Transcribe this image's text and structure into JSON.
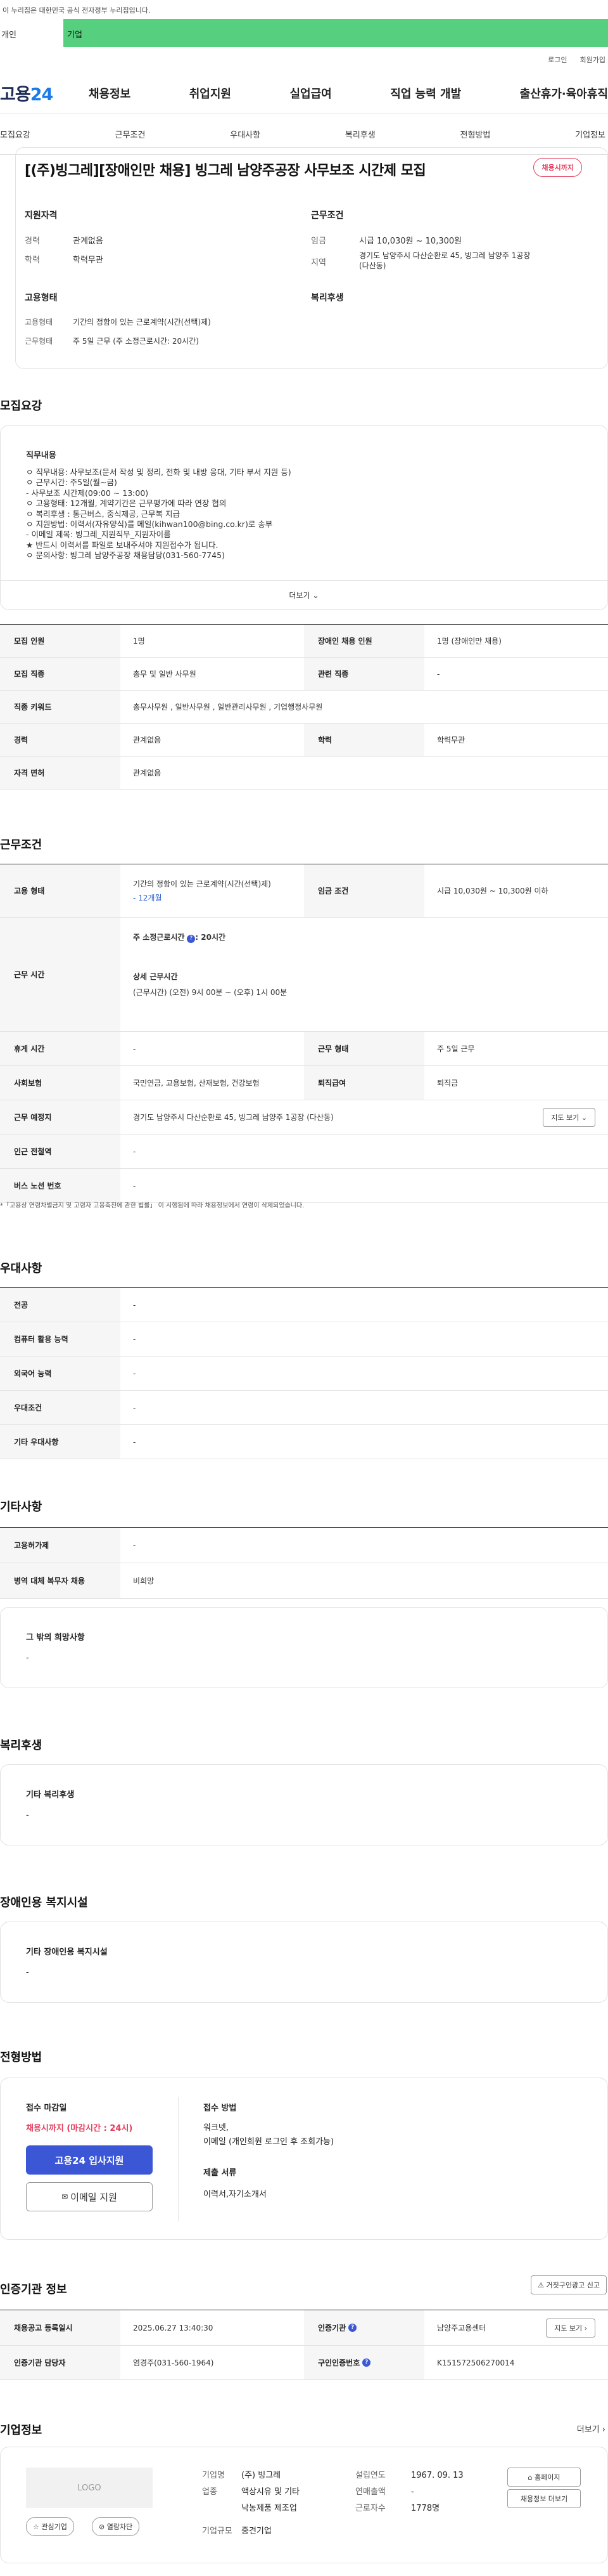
{
  "gov_banner": "이 누리집은 대한민국 공식 전자정부 누리집입니다.",
  "topbar": {
    "left": "개인",
    "right": "기업"
  },
  "util": {
    "login": "로그인",
    "join": "회원가입"
  },
  "logo": {
    "a": "고용",
    "b": "24"
  },
  "gnb": [
    "채용정보",
    "취업지원",
    "실업급여",
    "직업 능력 개발",
    "출산휴가·육아휴직"
  ],
  "tabs": [
    "모집요강",
    "근무조건",
    "우대사항",
    "복리후생",
    "전형방법",
    "기업정보"
  ],
  "job": {
    "title": "[(주)빙그레][장애인만 채용] 빙그레 남양주공장 사무보조 시간제 모집",
    "badge": "채용시까지",
    "qual_h": "지원자격",
    "cond_h": "근무조건",
    "career_k": "경력",
    "career_v": "관계없음",
    "edu_k": "학력",
    "edu_v": "학력무관",
    "wage_k": "임금",
    "wage_v": "시급 10,030원 ~ 10,300원",
    "loc_k": "지역",
    "loc_v1": "경기도 남양주시 다산순환로 45, 빙그레 남양주 1공장",
    "loc_v2": "(다산동)",
    "emp_h": "고용형태",
    "welfare_h": "복리후생",
    "emp_k": "고용형태",
    "emp_v": "기간의 정함이 있는 근로계약(시간(선택)제)",
    "work_k": "근무형태",
    "work_v": "주 5일 근무 (주 소정근로시간: 20시간)"
  },
  "recruit": {
    "heading": "모집요강",
    "desc_h": "직무내용",
    "lines": [
      "ㅇ 직무내용: 사무보조(문서 작성 및 정리, 전화 및 내방 응대, 기타 부서 지원 등)",
      "ㅇ 근무시간: 주5일(월~금)",
      "- 사무보조 시간제(09:00 ~ 13:00)",
      "ㅇ 고용형태: 12개월, 계약기간은 근무평가에 따라 연장 협의",
      "ㅇ 복리후생 : 통근버스, 중식제공, 근무복 지급",
      "ㅇ 지원방법: 이력서(자유양식)를 메일(kihwan100@bing.co.kr)로 송부",
      "- 이메일 제목: 빙그레_지원직무_지원자이름",
      "★ 반드시 이력서를 파일로 보내주셔야 지원접수가 됩니다.",
      "ㅇ 문의사항: 빙그레 남양주공장 채용담당(031-560-7745)"
    ],
    "more": "더보기"
  },
  "recruit_table": [
    {
      "k1": "모집 인원",
      "v1": "1명",
      "k2": "장애인 채용 인원",
      "v2": "1명 (장애인만 채용)"
    },
    {
      "k1": "모집 직종",
      "v1": "총무 및 일반 사무원",
      "k2": "관련 직종",
      "v2": "-"
    },
    {
      "k1": "직종 키워드",
      "v1": "총무사무원 , 일반사무원 , 일반관리사무원 , 기업행정사무원",
      "k2": "",
      "v2": ""
    },
    {
      "k1": "경력",
      "v1": "관계없음",
      "k2": "학력",
      "v2": "학력무관"
    },
    {
      "k1": "자격 면허",
      "v1": "관계없음",
      "k2": "",
      "v2": ""
    }
  ],
  "work": {
    "heading": "근무조건",
    "emp_k": "고용 형태",
    "emp_v1": "기간의 정함이 있는 근로계약(시간(선택)제)",
    "emp_v2": "- 12개월",
    "wage_k": "임금 조건",
    "wage_v": "시급 10,030원 ~ 10,300원 이하",
    "time_k": "근무 시간",
    "time_1a": "주 소정근로시간",
    "time_1b": ": 20시간",
    "time_2": "상세 근무시간",
    "time_3": "(근무시간) (오전) 9시 00분 ~ (오후) 1시 00분",
    "rest_k": "휴게 시간",
    "rest_v": "-",
    "shape_k": "근무 형태",
    "shape_v": "주 5일 근무",
    "ins_k": "사회보험",
    "ins_v": "국민연금, 고용보험, 산재보험, 건강보험",
    "ret_k": "퇴직급여",
    "ret_v": "퇴직금",
    "loc_k": "근무 예정지",
    "loc_v": "경기도 남양주시 다산순환로 45, 빙그레 남양주 1공장 (다산동)",
    "map_btn": "지도 보기",
    "sub_k": "인근 전철역",
    "sub_v": "-",
    "bus_k": "버스 노선 번호",
    "bus_v": "-",
    "note": "「고용상 연령차별금지 및 고령자 고용촉진에 관한 법률」 이 시행됨에 따라 채용정보에서 연령이 삭제되었습니다."
  },
  "pref": {
    "heading": "우대사항",
    "rows": [
      {
        "k": "전공",
        "v": "-"
      },
      {
        "k": "컴퓨터 활용 능력",
        "v": "-"
      },
      {
        "k": "외국어 능력",
        "v": "-"
      },
      {
        "k": "우대조건",
        "v": "-"
      },
      {
        "k": "기타 우대사항",
        "v": "-"
      }
    ]
  },
  "etc": {
    "heading": "기타사항",
    "rows": [
      {
        "k": "고용허가제",
        "v": "-"
      },
      {
        "k": "병역 대체 복무자 채용",
        "v": "비희망"
      }
    ],
    "wish_h": "그 밖의 희망사항",
    "wish_v": "-"
  },
  "welfare": {
    "heading": "복리후생",
    "h": "기타 복리후생",
    "v": "-"
  },
  "disab": {
    "heading": "장애인용 복지시설",
    "h": "기타 장애인용 복지시설",
    "v": "-"
  },
  "process": {
    "heading": "전형방법",
    "deadline_h": "접수 마감일",
    "deadline_v": "채용시까지 (마감시간 : 24시)",
    "apply_btn": "고용24 입사지원",
    "email_btn": "이메일 지원",
    "method_h": "접수 방법",
    "method_v1": "워크넷,",
    "method_v2": "이메일 (개인회원 로그인 후 조회가능)",
    "docs_h": "제출 서류",
    "docs_v": "이력서,자기소개서"
  },
  "cert": {
    "heading": "인증기관 정보",
    "report_btn": "거짓구인광고 신고",
    "reg_k": "채용공고 등록일시",
    "reg_v": "2025.06.27 13:40:30",
    "org_k": "인증기관",
    "org_v": "남양주고용센터",
    "map_btn": "지도 보기",
    "mgr_k": "인증기관 담당자",
    "mgr_v": "염경주(031-560-1964)",
    "no_k": "구인인증번호",
    "no_v": "K151572506270014"
  },
  "company": {
    "heading": "기업정보",
    "more": "더보기",
    "logo": "LOGO",
    "fav_btn": "관심기업",
    "block_btn": "열람차단",
    "name_k": "기업명",
    "name_v": "(주) 빙그레",
    "biz_k": "업종",
    "biz_v1": "액상시유 및 기타",
    "biz_v2": "낙농제품 제조업",
    "size_k": "기업규모",
    "size_v": "중견기업",
    "year_k": "설립연도",
    "year_v": "1967. 09. 13",
    "sales_k": "연매출액",
    "sales_v": "-",
    "staff_k": "근로자수",
    "staff_v": "1778명",
    "home_btn": "홈페이지",
    "info_btn": "채용정보 더보기"
  },
  "colors": {
    "accent": "#3c57d6",
    "green": "#56cf7e",
    "red": "#e33b5c"
  }
}
